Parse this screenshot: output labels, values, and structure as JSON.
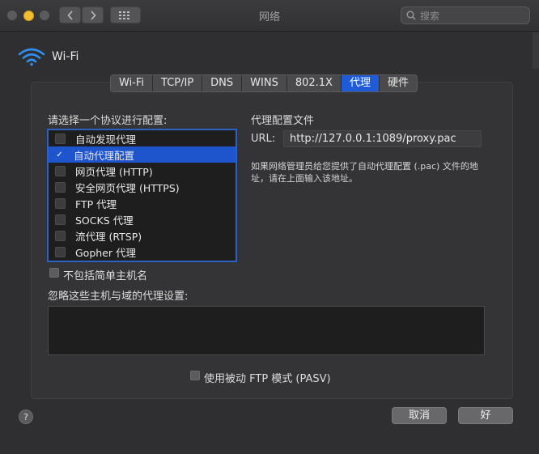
{
  "window": {
    "title": "网络",
    "search_placeholder": "搜索"
  },
  "network": {
    "interface_name": "Wi-Fi"
  },
  "tabs": [
    {
      "label": "Wi-Fi",
      "active": false
    },
    {
      "label": "TCP/IP",
      "active": false
    },
    {
      "label": "DNS",
      "active": false
    },
    {
      "label": "WINS",
      "active": false
    },
    {
      "label": "802.1X",
      "active": false
    },
    {
      "label": "代理",
      "active": true
    },
    {
      "label": "硬件",
      "active": false
    }
  ],
  "proxy": {
    "list_heading": "请选择一个协议进行配置:",
    "protocols": [
      {
        "label": "自动发现代理",
        "checked": false,
        "selected": false
      },
      {
        "label": "自动代理配置",
        "checked": true,
        "selected": true
      },
      {
        "label": "网页代理 (HTTP)",
        "checked": false,
        "selected": false
      },
      {
        "label": "安全网页代理 (HTTPS)",
        "checked": false,
        "selected": false
      },
      {
        "label": "FTP 代理",
        "checked": false,
        "selected": false
      },
      {
        "label": "SOCKS 代理",
        "checked": false,
        "selected": false
      },
      {
        "label": "流代理 (RTSP)",
        "checked": false,
        "selected": false
      },
      {
        "label": "Gopher 代理",
        "checked": false,
        "selected": false
      }
    ],
    "config_file_heading": "代理配置文件",
    "url_label": "URL:",
    "url_value": "http://127.0.0.1:1089/proxy.pac",
    "help_text": "如果网络管理员给您提供了自动代理配置 (.pac) 文件的地址，请在上面输入该地址。",
    "exclude_simple_hostnames_label": "不包括简单主机名",
    "exclude_simple_hostnames_checked": false,
    "bypass_heading": "忽略这些主机与域的代理设置:",
    "bypass_value": "",
    "passive_ftp_label": "使用被动 FTP 模式 (PASV)",
    "passive_ftp_checked": false
  },
  "footer": {
    "help_label": "?",
    "cancel_label": "取消",
    "ok_label": "好"
  },
  "colors": {
    "accent": "#1f5bd6",
    "background": "#2f2f31"
  }
}
